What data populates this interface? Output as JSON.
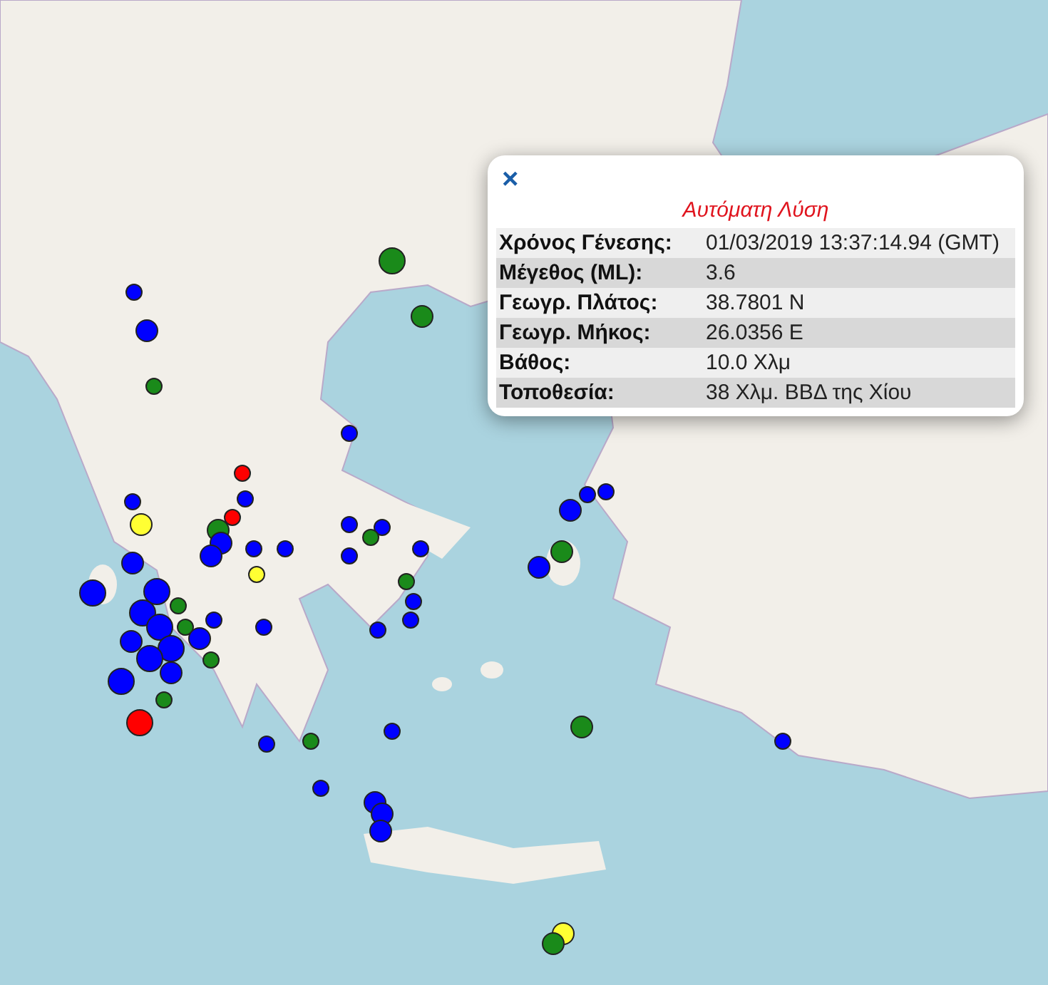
{
  "map": {
    "markers": [
      {
        "color": "#1a8a1a",
        "kind": "large"
      },
      {
        "color": "#1a8a1a",
        "kind": "medium"
      },
      {
        "color": "#0000ff",
        "kind": "small"
      },
      {
        "color": "#0000ff",
        "kind": "medium"
      },
      {
        "color": "#1a8a1a",
        "kind": "small"
      },
      {
        "color": "#0000ff",
        "kind": "small"
      },
      {
        "color": "#ff0000",
        "kind": "small"
      },
      {
        "color": "#0000ff",
        "kind": "small"
      },
      {
        "color": "#0000ff",
        "kind": "small"
      },
      {
        "color": "#ffff33",
        "kind": "medium"
      },
      {
        "color": "#ff0000",
        "kind": "small"
      },
      {
        "color": "#1a8a1a",
        "kind": "medium"
      },
      {
        "color": "#0000ff",
        "kind": "medium"
      },
      {
        "color": "#0000ff",
        "kind": "small"
      },
      {
        "color": "#0000ff",
        "kind": "small"
      },
      {
        "color": "#0000ff",
        "kind": "medium"
      },
      {
        "color": "#ffff33",
        "kind": "small"
      },
      {
        "color": "#0000ff",
        "kind": "small"
      },
      {
        "color": "#0000ff",
        "kind": "small"
      },
      {
        "color": "#1a8a1a",
        "kind": "small"
      },
      {
        "color": "#0000ff",
        "kind": "small"
      },
      {
        "color": "#0000ff",
        "kind": "small"
      },
      {
        "color": "#1a8a1a",
        "kind": "small"
      },
      {
        "color": "#0000ff",
        "kind": "small"
      },
      {
        "color": "#0000ff",
        "kind": "small"
      },
      {
        "color": "#0000ff",
        "kind": "small"
      },
      {
        "color": "#0000ff",
        "kind": "large"
      },
      {
        "color": "#0000ff",
        "kind": "medium"
      },
      {
        "color": "#0000ff",
        "kind": "large"
      },
      {
        "color": "#0000ff",
        "kind": "large"
      },
      {
        "color": "#0000ff",
        "kind": "large"
      },
      {
        "color": "#0000ff",
        "kind": "large"
      },
      {
        "color": "#0000ff",
        "kind": "medium"
      },
      {
        "color": "#0000ff",
        "kind": "large"
      },
      {
        "color": "#1a8a1a",
        "kind": "small"
      },
      {
        "color": "#1a8a1a",
        "kind": "small"
      },
      {
        "color": "#0000ff",
        "kind": "medium"
      },
      {
        "color": "#0000ff",
        "kind": "small"
      },
      {
        "color": "#1a8a1a",
        "kind": "small"
      },
      {
        "color": "#0000ff",
        "kind": "medium"
      },
      {
        "color": "#0000ff",
        "kind": "large"
      },
      {
        "color": "#ff0000",
        "kind": "large"
      },
      {
        "color": "#1a8a1a",
        "kind": "small"
      },
      {
        "color": "#0000ff",
        "kind": "small"
      },
      {
        "color": "#0000ff",
        "kind": "small"
      },
      {
        "color": "#1a8a1a",
        "kind": "small"
      },
      {
        "color": "#0000ff",
        "kind": "small"
      },
      {
        "color": "#0000ff",
        "kind": "small"
      },
      {
        "color": "#0000ff",
        "kind": "medium"
      },
      {
        "color": "#0000ff",
        "kind": "medium"
      },
      {
        "color": "#0000ff",
        "kind": "medium"
      },
      {
        "color": "#1a8a1a",
        "kind": "medium"
      },
      {
        "color": "#0000ff",
        "kind": "small"
      },
      {
        "color": "#ffff33",
        "kind": "medium"
      },
      {
        "color": "#1a8a1a",
        "kind": "medium"
      },
      {
        "color": "#0000ff",
        "kind": "medium"
      },
      {
        "color": "#1a8a1a",
        "kind": "medium"
      },
      {
        "color": "#0000ff",
        "kind": "small"
      },
      {
        "color": "#0000ff",
        "kind": "small"
      },
      {
        "color": "#0000ff",
        "kind": "medium"
      }
    ]
  },
  "popup": {
    "close": "×",
    "title": "Αυτόματη Λύση",
    "rows": [
      {
        "label": "Χρόνος Γένεσης:",
        "value": "01/03/2019 13:37:14.94 (GMT)"
      },
      {
        "label": "Μέγεθος (ML):",
        "value": "3.6"
      },
      {
        "label": "Γεωγρ. Πλάτος:",
        "value": "38.7801 N"
      },
      {
        "label": "Γεωγρ. Μήκος:",
        "value": "26.0356 E"
      },
      {
        "label": "Βάθος:",
        "value": "10.0 Χλμ"
      },
      {
        "label": "Τοποθεσία:",
        "value": "38 Χλμ. ΒΒΔ της Χίου"
      }
    ]
  }
}
